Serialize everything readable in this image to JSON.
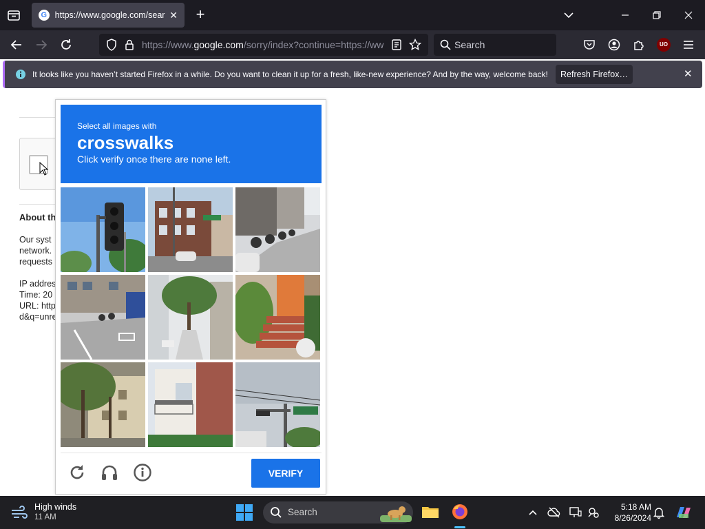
{
  "browser": {
    "tab": {
      "title": "https://www.google.com/sear",
      "favicon": "G"
    },
    "url": {
      "prefix": "https://www.",
      "host": "google.com",
      "rest": "/sorry/index?continue=https://ww"
    },
    "search_placeholder": "Search",
    "notification": {
      "message": "It looks like you haven’t started Firefox in a while. Do you want to clean it up for a fresh, like-new experience? And by the way, welcome back!",
      "button": "Refresh Firefox…"
    },
    "ext_badge": "UO"
  },
  "page": {
    "about_heading": "About th",
    "paragraph_lines": [
      "Our syst",
      "network.",
      "requests"
    ],
    "info_lines": [
      "IP addres",
      "Time: 20",
      "URL: http",
      "d&q=unre"
    ]
  },
  "captcha": {
    "instruction_small": "Select all images with",
    "target": "crosswalks",
    "instruction_sub": "Click verify once there are none left.",
    "verify_label": "VERIFY",
    "tiles": [
      "traffic-light-sky",
      "brick-building-street",
      "parked-scooters-street",
      "street-crossing-corner",
      "tree-lined-alley",
      "red-stairs-entrance",
      "trees-apartment",
      "white-house-balcony",
      "traffic-signal-pole"
    ],
    "accent": "#1a73e8"
  },
  "taskbar": {
    "weather_title": "High winds",
    "weather_time": "11 AM",
    "search_placeholder": "Search",
    "time": "5:18 AM",
    "date": "8/26/2024"
  }
}
